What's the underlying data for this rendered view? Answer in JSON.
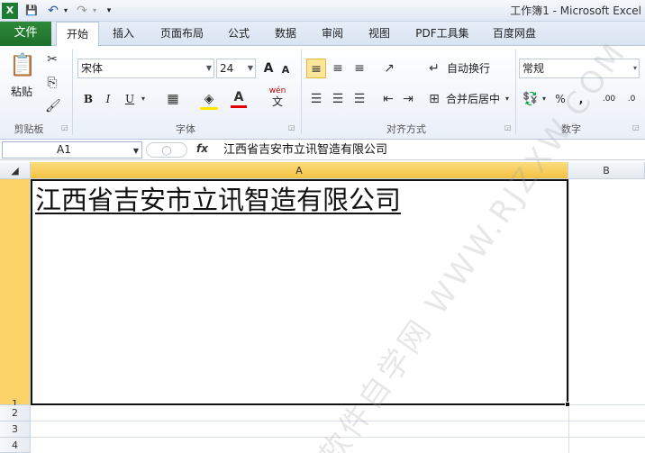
{
  "window": {
    "title": "工作簿1 - Microsoft Excel",
    "quick_access": [
      {
        "name": "excel-app-icon",
        "glyph": "X"
      },
      {
        "name": "save-icon",
        "glyph": "💾"
      },
      {
        "name": "undo-icon",
        "glyph": "↶"
      },
      {
        "name": "redo-icon",
        "glyph": "↷"
      },
      {
        "name": "customize-qat-icon",
        "glyph": "▾"
      }
    ]
  },
  "tabs": {
    "file": "文件",
    "items": [
      "开始",
      "插入",
      "页面布局",
      "公式",
      "数据",
      "审阅",
      "视图",
      "PDF工具集",
      "百度网盘"
    ],
    "active": "开始"
  },
  "ribbon": {
    "clipboard": {
      "label": "剪贴板",
      "paste_label": "粘贴"
    },
    "font": {
      "label": "字体",
      "font_name": "宋体",
      "font_size": "24",
      "bold": "B",
      "italic": "I",
      "underline": "U",
      "grow": "A",
      "shrink": "A",
      "phonetic": "wén",
      "phonetic_char": "文"
    },
    "alignment": {
      "label": "对齐方式",
      "wrap_text": "自动换行",
      "merge_center": "合并后居中"
    },
    "number": {
      "label": "数字",
      "format": "常规",
      "percent": "%",
      "comma": ",",
      "inc_decimal": ".00",
      "dec_decimal": ".0"
    }
  },
  "formula_bar": {
    "name_box": "A1",
    "fx": "fx",
    "content": "江西省吉安市立讯智造有限公司"
  },
  "sheet": {
    "columns": [
      "A",
      "B"
    ],
    "rows": [
      "1",
      "2",
      "3",
      "4"
    ],
    "cells": {
      "A1": "江西省吉安市立讯智造有限公司"
    },
    "selected": "A1"
  },
  "watermark": "软件自学网 WWW.RJZXW.COM"
}
